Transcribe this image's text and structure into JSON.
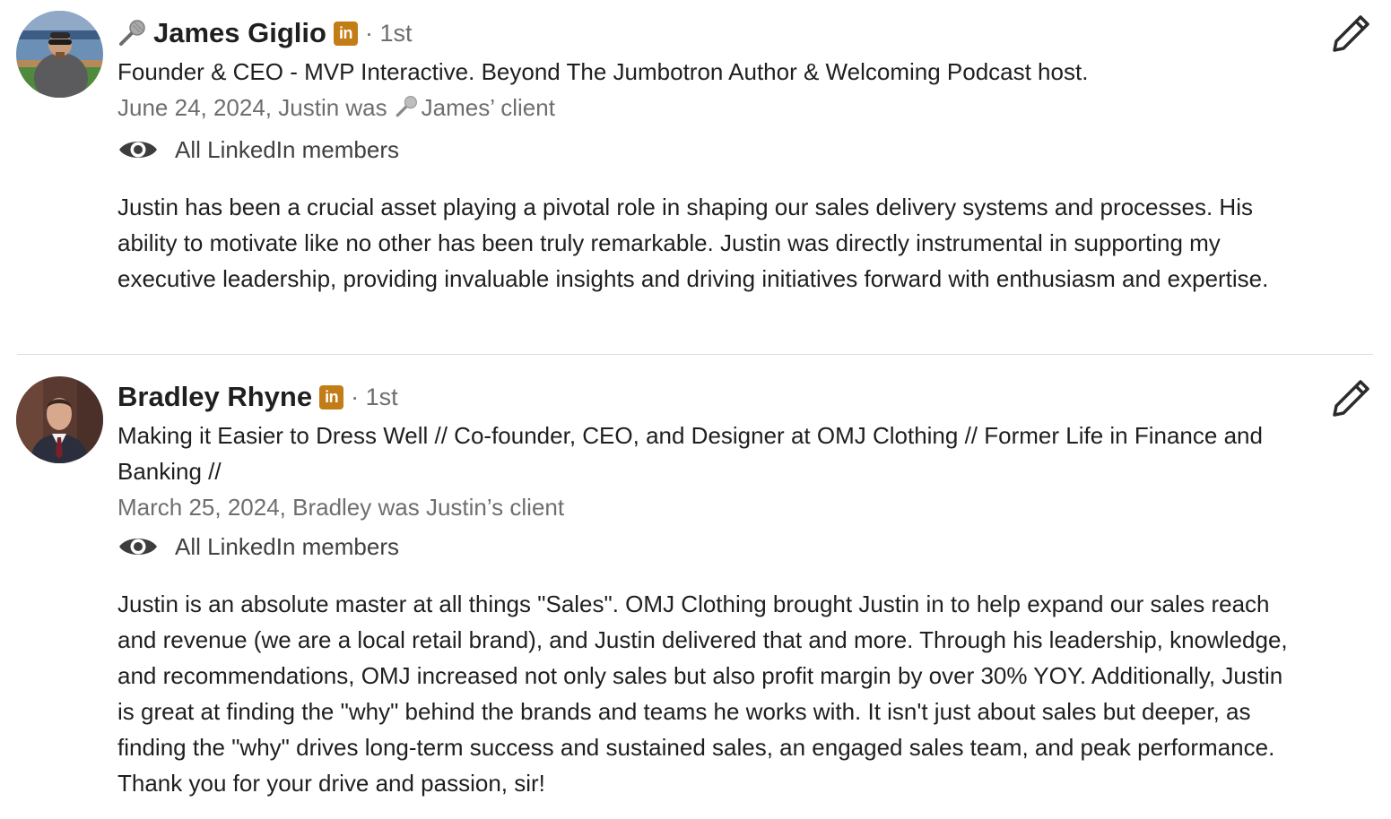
{
  "recommendations": [
    {
      "name": "James Giglio",
      "name_prefix_icon": "microphone-icon",
      "linkedin_badge": "in",
      "degree": "· 1st",
      "headline": "Founder & CEO - MVP Interactive. Beyond The Jumbotron Author & Welcoming Podcast host.",
      "relation_prefix": "June 24, 2024, Justin was",
      "relation_suffix": "James’ client",
      "visibility": "All LinkedIn members",
      "text": "Justin has been a crucial asset playing a pivotal role in shaping our sales delivery systems and processes. His ability to motivate like no other has been truly remarkable. Justin was directly instrumental in supporting my executive leadership, providing invaluable insights and driving initiatives forward with enthusiasm and expertise."
    },
    {
      "name": "Bradley Rhyne",
      "linkedin_badge": "in",
      "degree": "· 1st",
      "headline": "Making it Easier to Dress Well // Co-founder, CEO, and Designer at OMJ Clothing // Former Life in Finance and Banking //",
      "relation": "March 25, 2024, Bradley was Justin’s client",
      "visibility": "All LinkedIn members",
      "text": "Justin is an absolute master at all things \"Sales\". OMJ Clothing brought Justin in to help expand our sales reach and revenue (we are a local retail brand), and Justin delivered that and more. Through his leadership, knowledge, and recommendations, OMJ increased not only sales but also profit margin by over 30% YOY. Additionally, Justin is great at finding the \"why\" behind the brands and teams he works with. It isn't just about sales but deeper, as finding the \"why\" drives long-term success and sustained sales, an engaged sales team, and peak performance. Thank you for your drive and passion, sir!"
    }
  ],
  "icons": {
    "edit": "pencil-icon",
    "visibility": "eye-icon",
    "badge": "linkedin-icon"
  },
  "colors": {
    "linkedin_badge": "#c37d16",
    "text_primary": "#1f1f1f",
    "text_secondary": "#6e6e6e",
    "divider": "#dcdcdc"
  }
}
